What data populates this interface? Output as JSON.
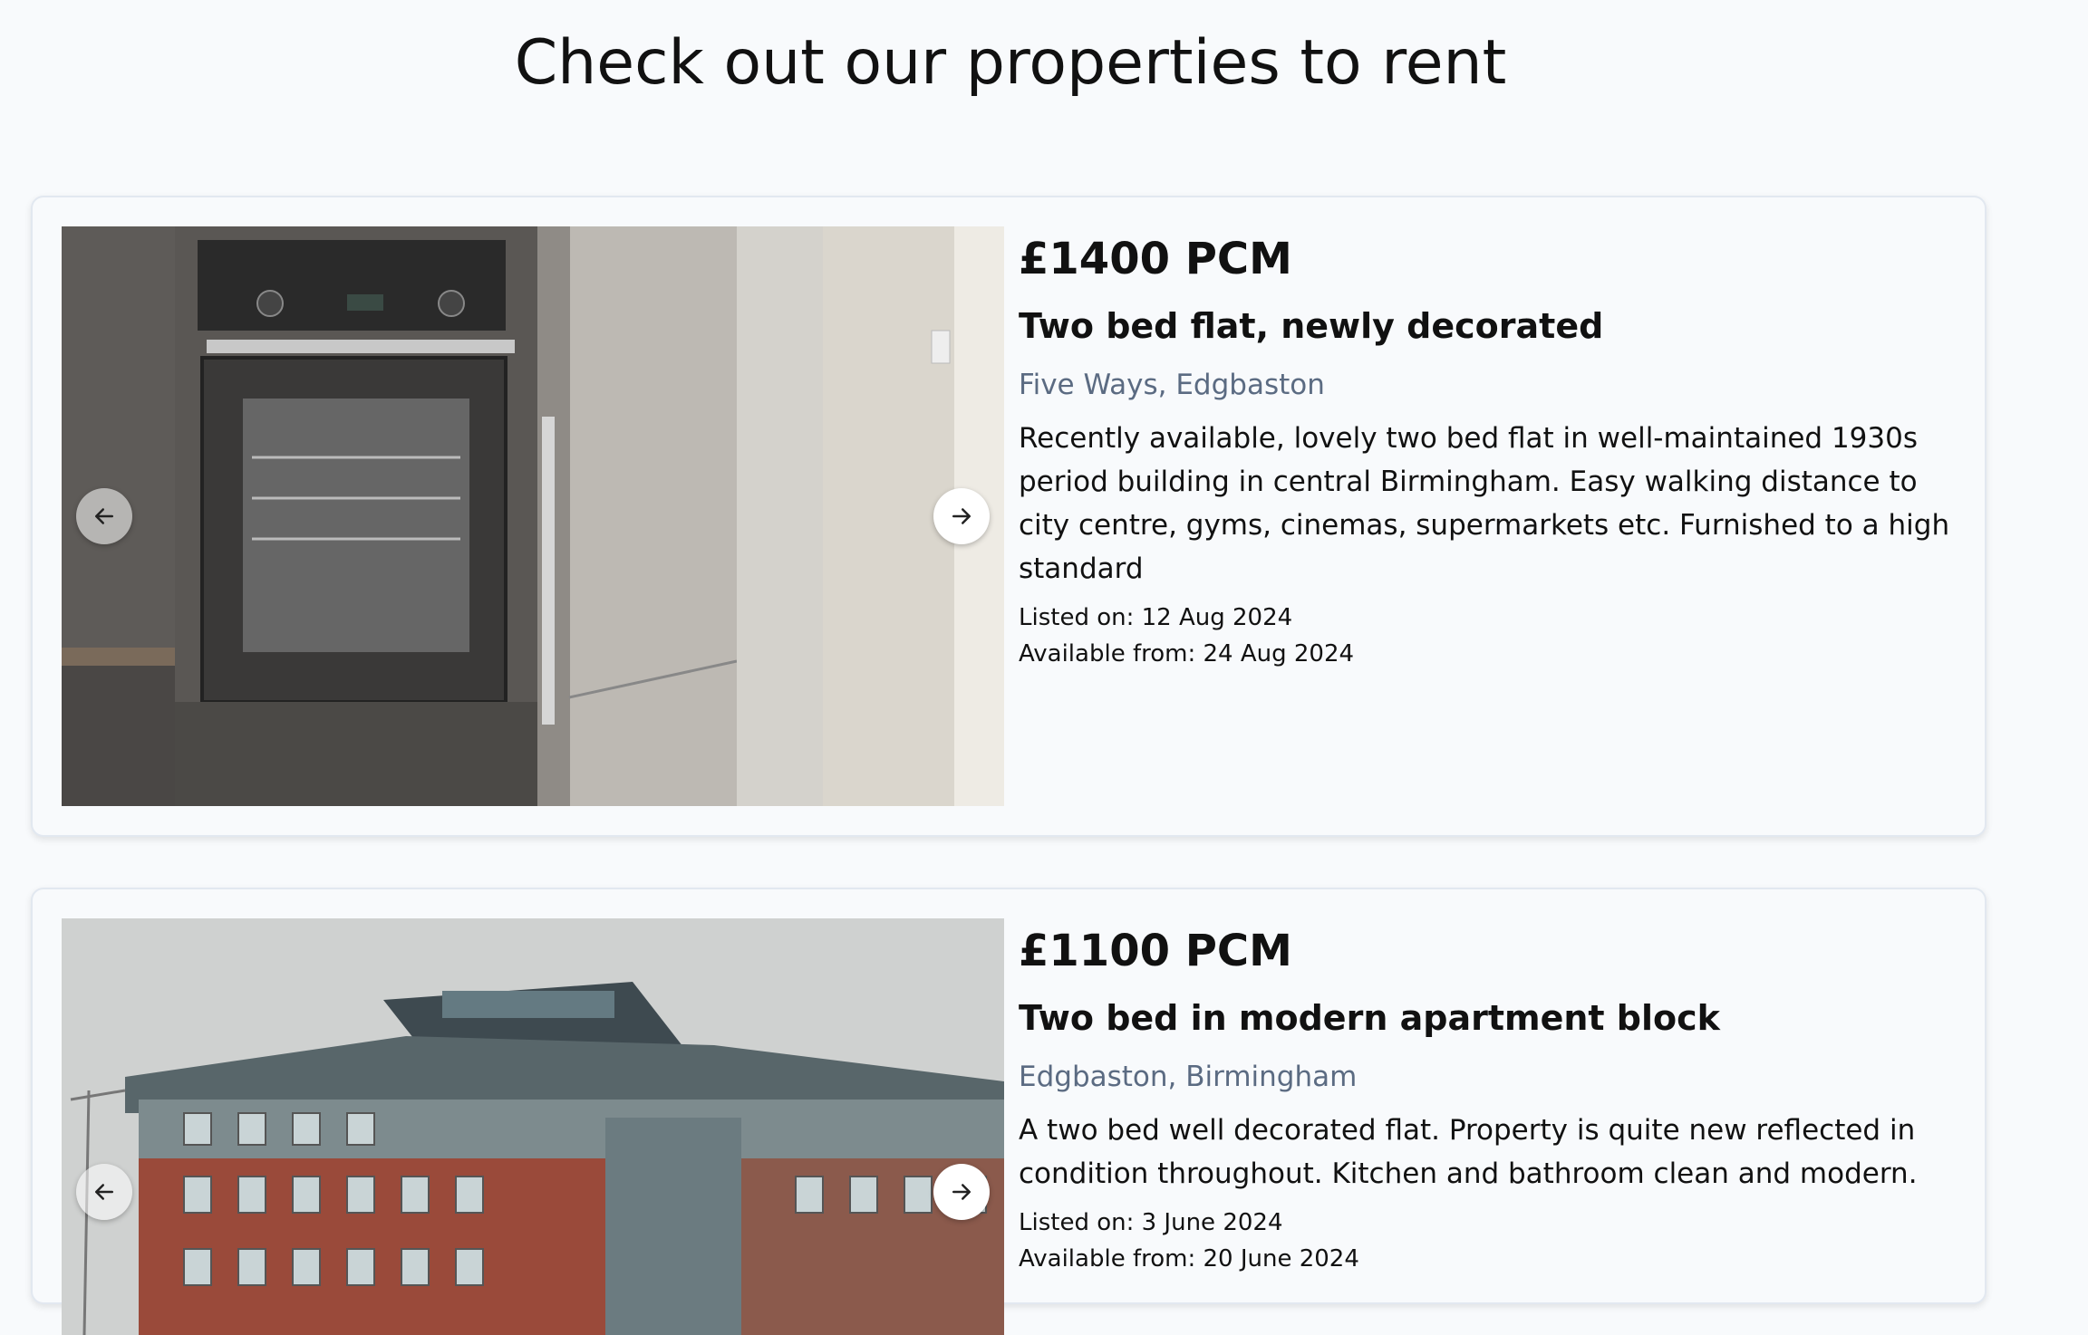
{
  "page": {
    "title": "Check out our properties to rent"
  },
  "listings": [
    {
      "price": "£1400 PCM",
      "title": "Two bed flat, newly decorated",
      "location": "Five Ways, Edgbaston",
      "description": "Recently available, lovely two bed flat in well-maintained 1930s period building in central Birmingham. Easy walking distance to city centre, gyms, cinemas, supermarkets etc. Furnished to a high standard",
      "listed_on": "Listed on: 12 Aug 2024",
      "available_from": "Available from: 24 Aug 2024"
    },
    {
      "price": "£1100 PCM",
      "title": "Two bed in modern apartment block",
      "location": "Edgbaston, Birmingham",
      "description": "A two bed well decorated flat. Property is quite new reflected in condition throughout. Kitchen and bathroom clean and modern.",
      "listed_on": "Listed on: 3 June 2024",
      "available_from": "Available from: 20 June 2024"
    }
  ],
  "icons": {
    "prev": "arrow-left-icon",
    "next": "arrow-right-icon"
  },
  "colors": {
    "background": "#f8fafc",
    "location_text": "#5b6b82",
    "card_border": "#e2e8f0"
  }
}
